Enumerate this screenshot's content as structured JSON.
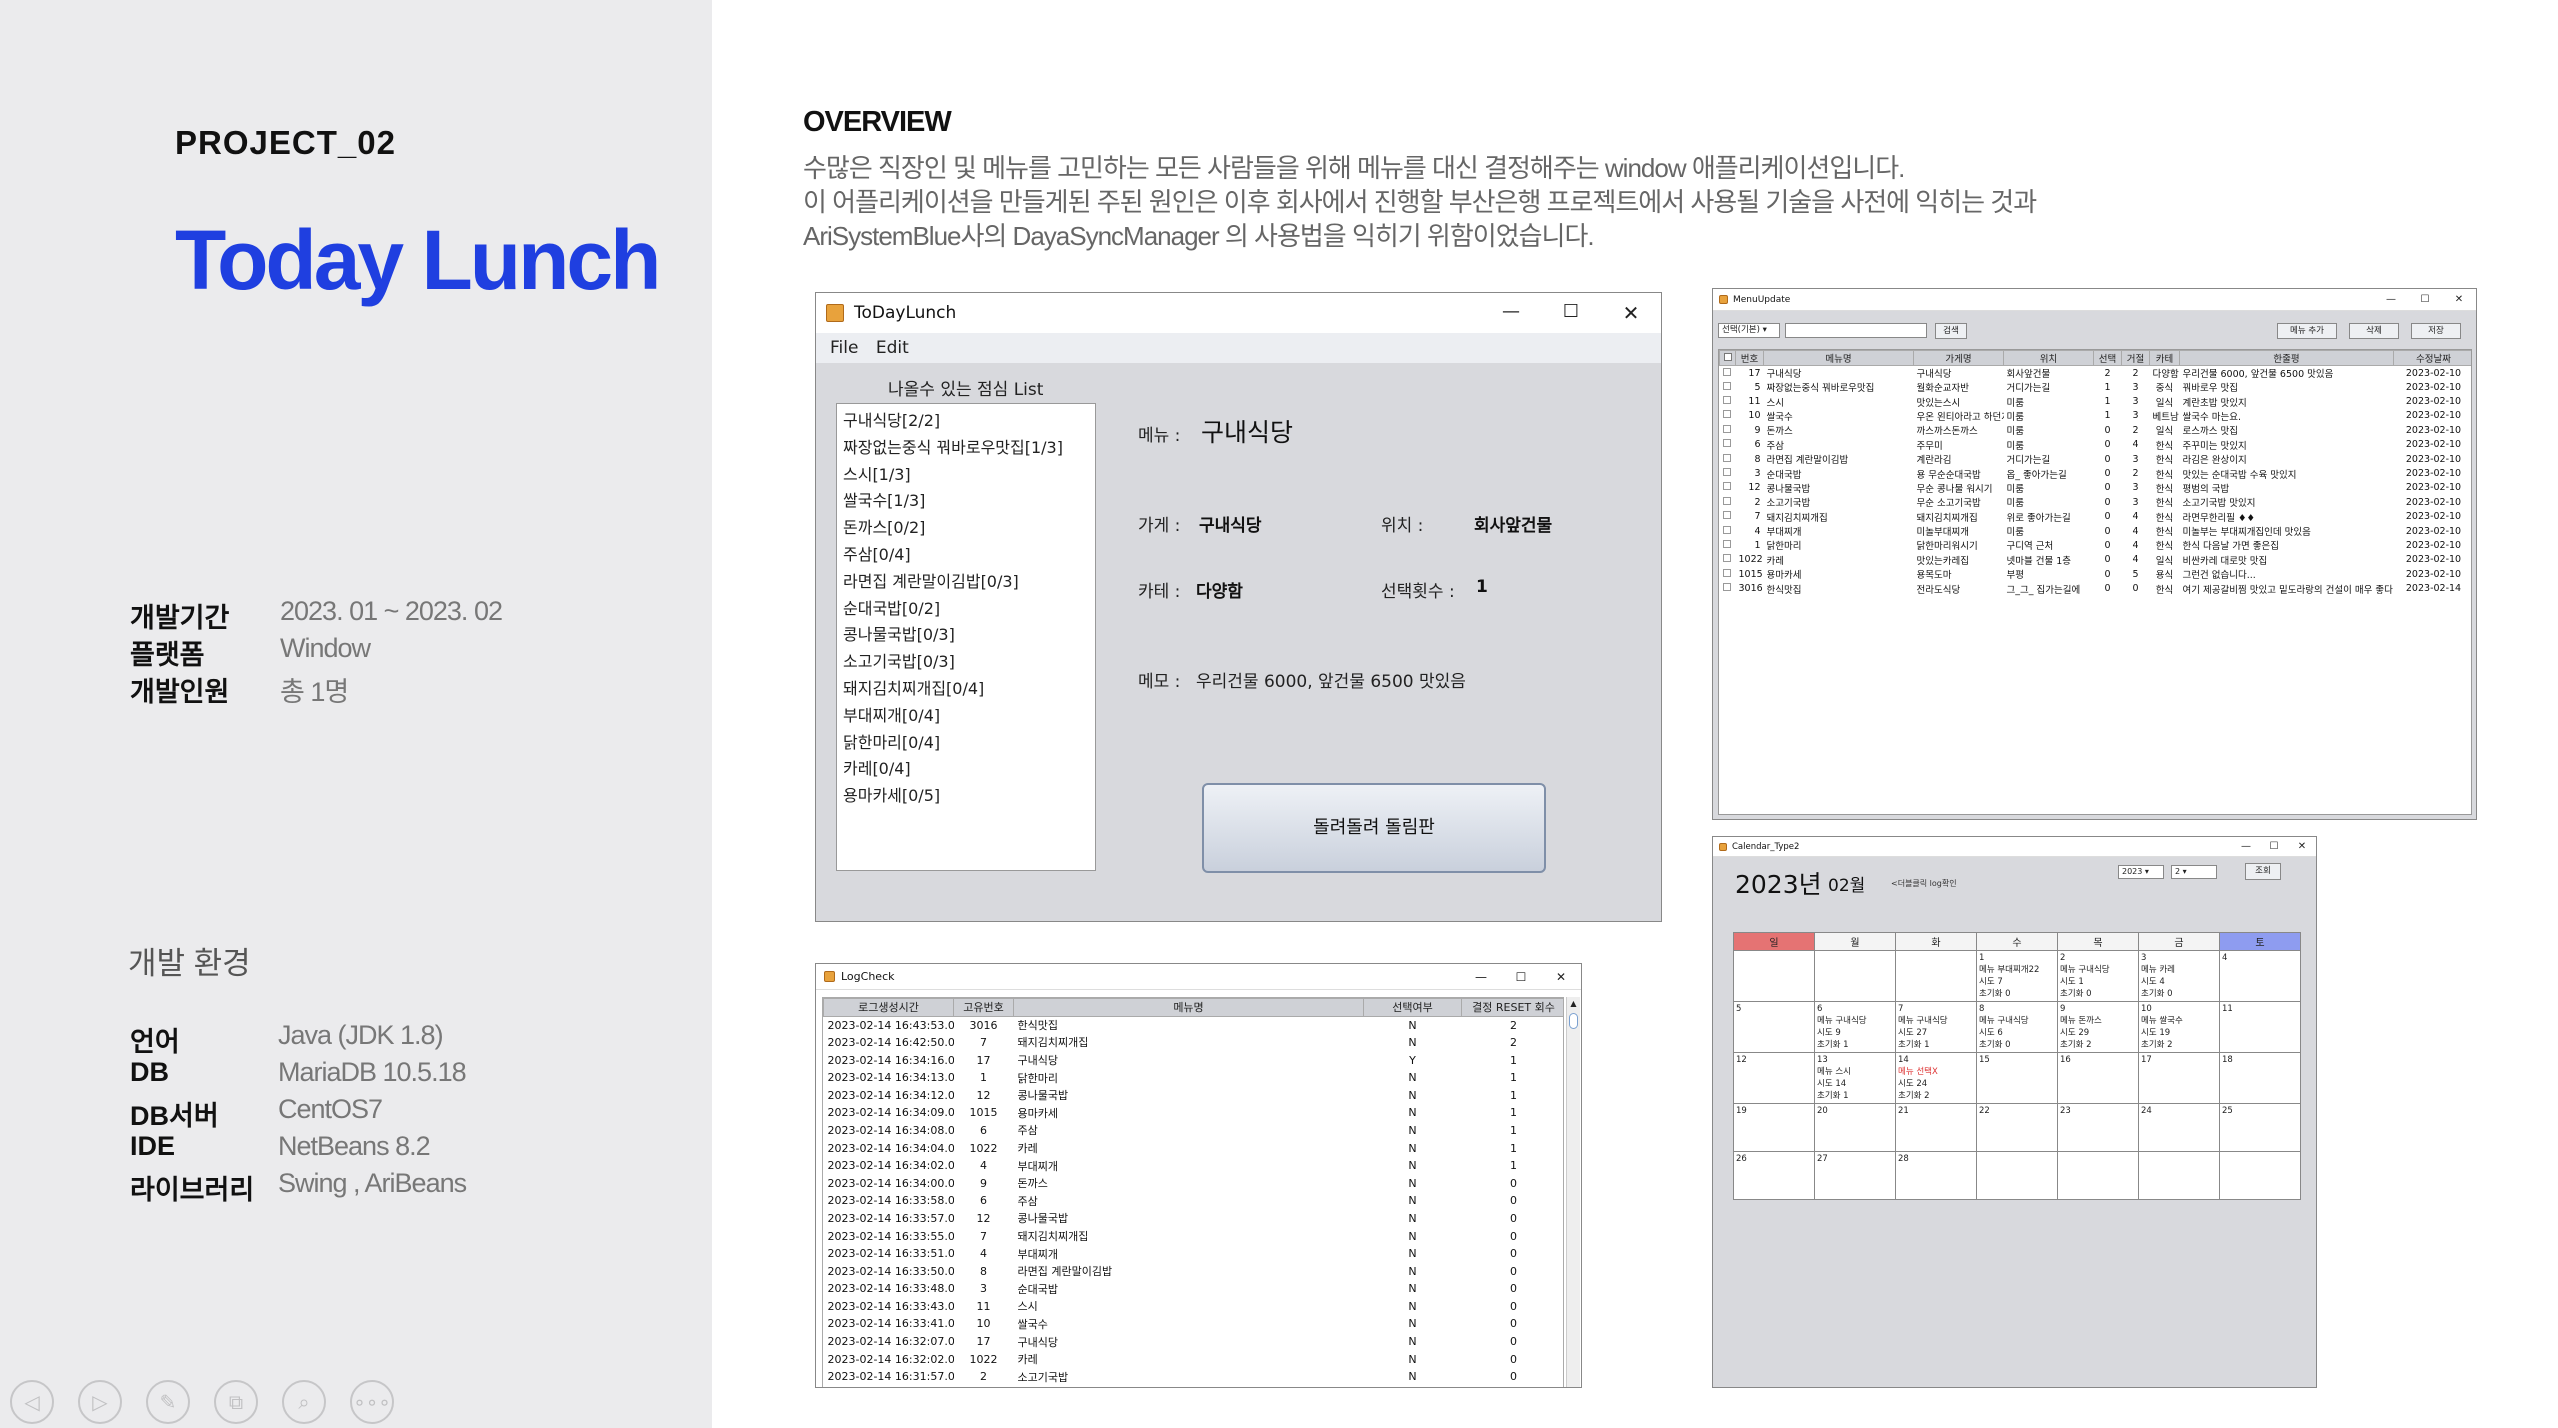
{
  "left": {
    "project": "PROJECT_02",
    "title": "Today Lunch",
    "info": [
      {
        "k": "개발기간",
        "v": "2023. 01 ~ 2023. 02"
      },
      {
        "k": "플랫폼",
        "v": "Window"
      },
      {
        "k": "개발인원",
        "v": "총 1명"
      }
    ],
    "env_heading": "개발 환경",
    "env": [
      {
        "k": "언어",
        "v": "Java (JDK 1.8)"
      },
      {
        "k": "DB",
        "v": "MariaDB 10.5.18"
      },
      {
        "k": "DB서버",
        "v": "CentOS7"
      },
      {
        "k": "IDE",
        "v": "NetBeans 8.2"
      },
      {
        "k": "라이브러리",
        "v": "Swing , AriBeans"
      }
    ],
    "nav_icons": [
      "◁",
      "▷",
      "✎",
      "⧉",
      "⌕",
      "∘∘∘"
    ]
  },
  "overview": {
    "heading": "OVERVIEW",
    "lines": [
      "수많은 직장인 및 메뉴를 고민하는 모든 사람들을 위해 메뉴를 대신 결정해주는  window 애플리케이션입니다.",
      "이 어플리케이션을 만들게된 주된 원인은 이후 회사에서 진행할 부산은행 프로젝트에서 사용될 기술을 사전에 익히는 것과",
      "AriSystemBlue사의 DayaSyncManager 의 사용법을 익히기 위함이었습니다."
    ]
  },
  "main_window": {
    "title": "ToDayLunch",
    "menu": [
      "File",
      "Edit"
    ],
    "list_title": "나올수 있는 점심 List",
    "list": [
      "구내식당[2/2]",
      "짜장없는중식 꿔바로우맛집[1/3]",
      "스시[1/3]",
      "쌀국수[1/3]",
      "돈까스[0/2]",
      "주삼[0/4]",
      "라면집 계란말이김밥[0/3]",
      "순대국밥[0/2]",
      "콩나물국밥[0/3]",
      "소고기국밥[0/3]",
      "돼지김치찌개집[0/4]",
      "부대찌개[0/4]",
      "닭한마리[0/4]",
      "카레[0/4]",
      "용마카세[0/5]"
    ],
    "menu_label": "메뉴 :",
    "menu_value": "구내식당",
    "store_label": "가게 :",
    "store_value": "구내식당",
    "loc_label": "위치 :",
    "loc_value": "회사앞건물",
    "cat_label": "카테 :",
    "cat_value": "다양함",
    "count_label": "선택횟수 :",
    "count_value": "1",
    "memo_label": "메모 :",
    "memo_value": "우리건물 6000, 앞건물 6500 맛있음",
    "spin_button": "돌려돌려 돌림판",
    "controls": [
      "—",
      "☐",
      "✕"
    ]
  },
  "log_window": {
    "title": "LogCheck",
    "headers": [
      "로그생성시간",
      "고유번호",
      "메뉴명",
      "선택여부",
      "결정 RESET 회수"
    ],
    "rows": [
      [
        "2023-02-14 16:43:53.0",
        "3016",
        "한식맛집",
        "N",
        "2"
      ],
      [
        "2023-02-14 16:42:50.0",
        "7",
        "돼지김치찌개집",
        "N",
        "2"
      ],
      [
        "2023-02-14 16:34:16.0",
        "17",
        "구내식당",
        "Y",
        "1"
      ],
      [
        "2023-02-14 16:34:13.0",
        "1",
        "닭한마리",
        "N",
        "1"
      ],
      [
        "2023-02-14 16:34:12.0",
        "12",
        "콩나물국밥",
        "N",
        "1"
      ],
      [
        "2023-02-14 16:34:09.0",
        "1015",
        "용마카세",
        "N",
        "1"
      ],
      [
        "2023-02-14 16:34:08.0",
        "6",
        "주삼",
        "N",
        "1"
      ],
      [
        "2023-02-14 16:34:04.0",
        "1022",
        "카레",
        "N",
        "1"
      ],
      [
        "2023-02-14 16:34:02.0",
        "4",
        "부대찌개",
        "N",
        "1"
      ],
      [
        "2023-02-14 16:34:00.0",
        "9",
        "돈까스",
        "N",
        "0"
      ],
      [
        "2023-02-14 16:33:58.0",
        "6",
        "주삼",
        "N",
        "0"
      ],
      [
        "2023-02-14 16:33:57.0",
        "12",
        "콩나물국밥",
        "N",
        "0"
      ],
      [
        "2023-02-14 16:33:55.0",
        "7",
        "돼지김치찌개집",
        "N",
        "0"
      ],
      [
        "2023-02-14 16:33:51.0",
        "4",
        "부대찌개",
        "N",
        "0"
      ],
      [
        "2023-02-14 16:33:50.0",
        "8",
        "라면집 계란말이김밥",
        "N",
        "0"
      ],
      [
        "2023-02-14 16:33:48.0",
        "3",
        "순대국밥",
        "N",
        "0"
      ],
      [
        "2023-02-14 16:33:43.0",
        "11",
        "스시",
        "N",
        "0"
      ],
      [
        "2023-02-14 16:33:41.0",
        "10",
        "쌀국수",
        "N",
        "0"
      ],
      [
        "2023-02-14 16:32:07.0",
        "17",
        "구내식당",
        "N",
        "0"
      ],
      [
        "2023-02-14 16:32:02.0",
        "1022",
        "카레",
        "N",
        "0"
      ],
      [
        "2023-02-14 16:31:57.0",
        "2",
        "소고기국밥",
        "N",
        "0"
      ]
    ]
  },
  "menu_update_window": {
    "title": "MenuUpdate",
    "select_value": "선택(기본)",
    "search_btn": "검색",
    "add_btn": "메뉴 추가",
    "delete_btn": "삭제",
    "save_btn": "저장",
    "headers": [
      "",
      "번호",
      "메뉴명",
      "가게명",
      "위치",
      "선택",
      "거절",
      "카테",
      "한줄평",
      "수정날짜"
    ],
    "rows": [
      [
        "17",
        "구내식당",
        "구내식당",
        "회사앞건물",
        "2",
        "2",
        "다양함",
        "우리건물 6000, 앞건물 6500 맛있음",
        "2023-02-10"
      ],
      [
        "5",
        "짜장없는중식 꿔바로우맛집",
        "월화순교자반",
        "거디가는길",
        "1",
        "3",
        "중식",
        "꿔바로우 맛집",
        "2023-02-10"
      ],
      [
        "11",
        "스시",
        "맛있는스시",
        "미룸",
        "1",
        "3",
        "일식",
        "계란초밥 맛있지",
        "2023-02-10"
      ],
      [
        "10",
        "쌀국수",
        "우온 왼티아라고 하던지",
        "미룸",
        "1",
        "3",
        "베트남",
        "쌀국수 마는요.",
        "2023-02-10"
      ],
      [
        "9",
        "돈까스",
        "까스까스돈까스",
        "미룸",
        "0",
        "2",
        "일식",
        "로스까스 맛집",
        "2023-02-10"
      ],
      [
        "6",
        "주삼",
        "주무미",
        "미룸",
        "0",
        "4",
        "한식",
        "주꾸미는 맛있지",
        "2023-02-10"
      ],
      [
        "8",
        "라면집 계란말이김밥",
        "계란라김",
        "거디가는길",
        "0",
        "3",
        "한식",
        "라김은 완상이지",
        "2023-02-10"
      ],
      [
        "3",
        "순대국밥",
        "용 무순순대국밥",
        "옵_ 좋아가는길",
        "0",
        "2",
        "한식",
        "맛있는 순대국밥 수육 맛있지",
        "2023-02-10"
      ],
      [
        "12",
        "콩나물국밥",
        "무순 콩나물 워시기",
        "미룸",
        "0",
        "3",
        "한식",
        "평범의 국밥",
        "2023-02-10"
      ],
      [
        "2",
        "소고기국밥",
        "무순 소고기국밥",
        "미룸",
        "0",
        "3",
        "한식",
        "소고기국밥 맛있지",
        "2023-02-10"
      ],
      [
        "7",
        "돼지김치찌개집",
        "돼지김치찌개집",
        "위로 좋아가는길",
        "0",
        "4",
        "한식",
        "라면무한리필 ♦♦",
        "2023-02-10"
      ],
      [
        "4",
        "부대찌개",
        "미놀부대찌개",
        "미룸",
        "0",
        "4",
        "한식",
        "미놀부는 부대찌개집인데 맛있음",
        "2023-02-10"
      ],
      [
        "1",
        "닭한마리",
        "닭한마리워시기",
        "구디역 근처",
        "0",
        "4",
        "한식",
        "한식 다음날 가면 좋은집",
        "2023-02-10"
      ],
      [
        "1022",
        "카레",
        "맛있는카레집",
        "넷마블 건물 1층",
        "0",
        "4",
        "일식",
        "비싼카레 대로맛 맛집",
        "2023-02-10"
      ],
      [
        "1015",
        "용마카세",
        "용목도마",
        "부평",
        "0",
        "5",
        "용식",
        "그런건 없습니다...",
        "2023-02-10"
      ],
      [
        "3016",
        "한식맛집",
        "전라도식당",
        "그_그_ 집가는길에",
        "0",
        "0",
        "한식",
        "여기 제공갈비찜 맛있고 밑도라랑의 건설이 매우 좋다",
        "2023-02-14"
      ]
    ]
  },
  "calendar_window": {
    "title": "Calendar_Type2",
    "year": "2023년",
    "month": "02월",
    "hint": "<더블클릭 log확인",
    "year_select": "2023",
    "month_select": "2",
    "query_btn": "조회",
    "weekdays": [
      "일",
      "월",
      "화",
      "수",
      "목",
      "금",
      "토"
    ],
    "weeks": [
      [
        {
          "d": ""
        },
        {
          "d": ""
        },
        {
          "d": ""
        },
        {
          "d": "1",
          "l": [
            "메뉴  부대찌개22",
            "시도  7",
            "초기화 0"
          ]
        },
        {
          "d": "2",
          "l": [
            "메뉴  구내식당",
            "시도  1",
            "초기화 0"
          ]
        },
        {
          "d": "3",
          "l": [
            "메뉴  카레",
            "시도  4",
            "초기화 0"
          ]
        },
        {
          "d": "4"
        }
      ],
      [
        {
          "d": "5"
        },
        {
          "d": "6",
          "l": [
            "메뉴  구내식당",
            "시도  9",
            "초기화 1"
          ]
        },
        {
          "d": "7",
          "l": [
            "메뉴  구내식당",
            "시도  27",
            "초기화 1"
          ]
        },
        {
          "d": "8",
          "l": [
            "메뉴  구내식당",
            "시도  6",
            "초기화 0"
          ]
        },
        {
          "d": "9",
          "l": [
            "메뉴  돈까스",
            "시도  29",
            "초기화 2"
          ]
        },
        {
          "d": "10",
          "l": [
            "메뉴  쌀국수",
            "시도  19",
            "초기화 2"
          ]
        },
        {
          "d": "11"
        }
      ],
      [
        {
          "d": "12"
        },
        {
          "d": "13",
          "l": [
            "메뉴  스시",
            "시도  14",
            "초기화 1"
          ]
        },
        {
          "d": "14",
          "l": [
            "메뉴  선택X",
            "시도  24",
            "초기화 2"
          ]
        },
        {
          "d": "15"
        },
        {
          "d": "16"
        },
        {
          "d": "17"
        },
        {
          "d": "18"
        }
      ],
      [
        {
          "d": "19"
        },
        {
          "d": "20"
        },
        {
          "d": "21"
        },
        {
          "d": "22"
        },
        {
          "d": "23"
        },
        {
          "d": "24"
        },
        {
          "d": "25"
        }
      ],
      [
        {
          "d": "26"
        },
        {
          "d": "27"
        },
        {
          "d": "28"
        },
        {
          "d": ""
        },
        {
          "d": ""
        },
        {
          "d": ""
        },
        {
          "d": ""
        }
      ]
    ],
    "accent_sunday": "#e57373",
    "accent_saturday": "#8e9cf0"
  }
}
